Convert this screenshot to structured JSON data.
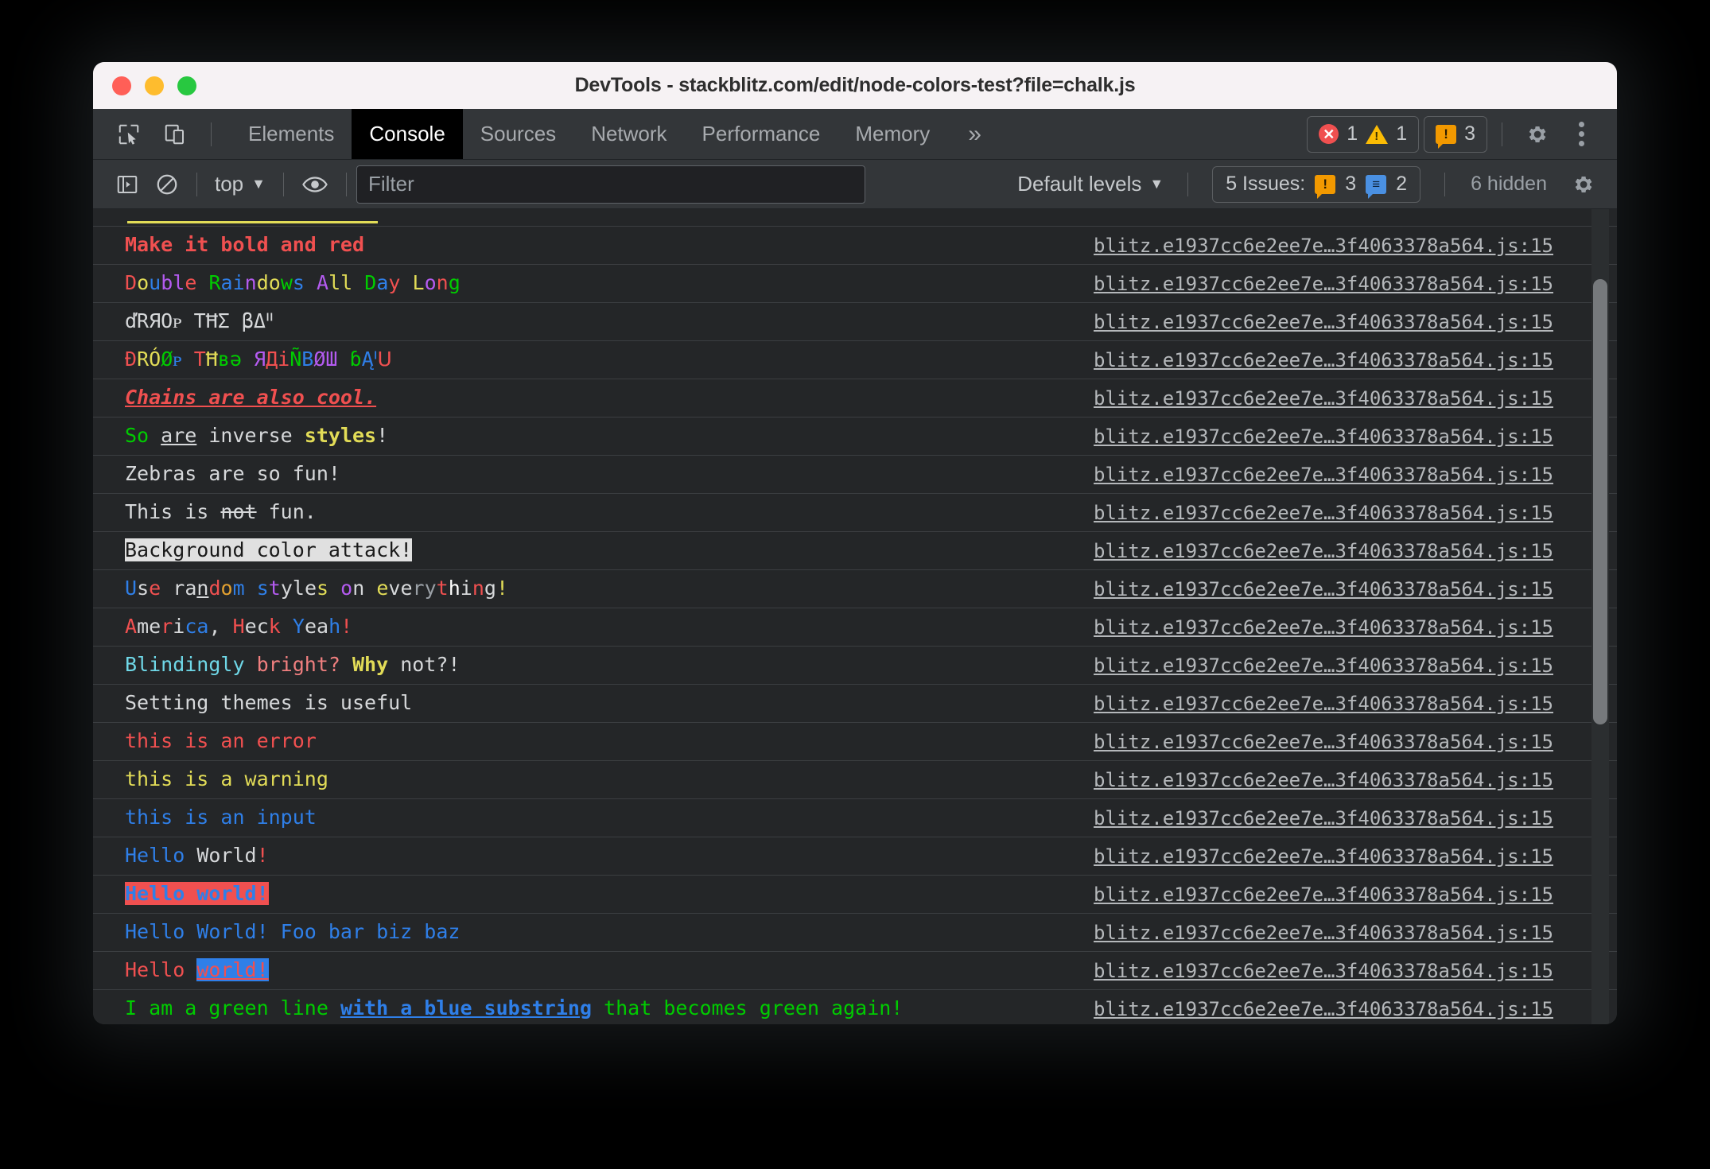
{
  "window": {
    "title": "DevTools - stackblitz.com/edit/node-colors-test?file=chalk.js",
    "traffic_lights": [
      "close",
      "minimize",
      "maximize"
    ]
  },
  "tabbar": {
    "inspect_icon": "inspect-element-icon",
    "device_icon": "device-toolbar-icon",
    "tabs": [
      {
        "label": "Elements",
        "active": false
      },
      {
        "label": "Console",
        "active": true
      },
      {
        "label": "Sources",
        "active": false
      },
      {
        "label": "Network",
        "active": false
      },
      {
        "label": "Performance",
        "active": false
      },
      {
        "label": "Memory",
        "active": false
      }
    ],
    "more_tabs_label": "»",
    "error_count": "1",
    "warning_count": "1",
    "issue_count": "3",
    "settings_icon": "gear-icon",
    "menu_icon": "kebab-menu-icon"
  },
  "console_toolbar": {
    "sidebar_icon": "console-sidebar-icon",
    "clear_icon": "clear-console-icon",
    "context_label": "top",
    "eye_icon": "live-expression-icon",
    "filter_placeholder": "Filter",
    "filter_value": "",
    "levels_label": "Default levels",
    "issues_label": "5 Issues:",
    "issues_orange_count": "3",
    "issues_blue_count": "2",
    "hidden_label": "6 hidden",
    "settings_icon": "console-settings-gear-icon"
  },
  "source_link": "blitz.e1937cc6e2ee7e…3f4063378a564.js:15",
  "colors": {
    "red": "#f05050",
    "green": "#00cc00",
    "blue": "#2f7fe8",
    "yellow": "#e2dc57",
    "magenta": "#b45bf0",
    "cyan": "#6fd8e8",
    "white": "#d6d8da",
    "grey": "#9aa0a6",
    "bg_white": "#e0e0e0",
    "bg_red": "#f05050",
    "bg_blue": "#2f7fe8"
  },
  "console_rows": [
    {
      "partial": true,
      "segments": []
    },
    {
      "segments": [
        {
          "t": "Make it bold and red",
          "c": "#f05050",
          "st": "b"
        }
      ]
    },
    {
      "segments": [
        {
          "t": "D",
          "c": "#f05050"
        },
        {
          "t": "o",
          "c": "#e2dc57"
        },
        {
          "t": "u",
          "c": "#2f7fe8"
        },
        {
          "t": "b",
          "c": "#b45bf0"
        },
        {
          "t": "l",
          "c": "#b45bf0"
        },
        {
          "t": "e",
          "c": "#f05050"
        },
        {
          "t": " ",
          "c": "#d6d8da"
        },
        {
          "t": "R",
          "c": "#00cc00"
        },
        {
          "t": "a",
          "c": "#2f7fe8"
        },
        {
          "t": "i",
          "c": "#2f7fe8"
        },
        {
          "t": "n",
          "c": "#b45bf0"
        },
        {
          "t": "d",
          "c": "#e2dc57"
        },
        {
          "t": "o",
          "c": "#e2dc57"
        },
        {
          "t": "w",
          "c": "#00cc00"
        },
        {
          "t": "s",
          "c": "#2f7fe8"
        },
        {
          "t": " ",
          "c": "#d6d8da"
        },
        {
          "t": "A",
          "c": "#b45bf0"
        },
        {
          "t": "l",
          "c": "#e2dc57"
        },
        {
          "t": "l",
          "c": "#e2dc57"
        },
        {
          "t": " ",
          "c": "#d6d8da"
        },
        {
          "t": "D",
          "c": "#00cc00"
        },
        {
          "t": "a",
          "c": "#2f7fe8"
        },
        {
          "t": "y",
          "c": "#f05050"
        },
        {
          "t": " ",
          "c": "#d6d8da"
        },
        {
          "t": "L",
          "c": "#e2dc57"
        },
        {
          "t": "o",
          "c": "#b45bf0"
        },
        {
          "t": "n",
          "c": "#f05050"
        },
        {
          "t": "g",
          "c": "#00cc00"
        }
      ]
    },
    {
      "segments": [
        {
          "t": "ďRЯOᴘ TĦΣ βΔᑊᑊ",
          "c": "#d6d8da"
        }
      ]
    },
    {
      "segments": [
        {
          "t": "Đ",
          "c": "#f05050"
        },
        {
          "t": "R",
          "c": "#e2dc57"
        },
        {
          "t": "Ó",
          "c": "#e2dc57"
        },
        {
          "t": "Ø",
          "c": "#00cc00"
        },
        {
          "t": "ᴘ",
          "c": "#2f7fe8"
        },
        {
          "t": " ",
          "c": "#d6d8da"
        },
        {
          "t": "T",
          "c": "#f05050"
        },
        {
          "t": "Ħ",
          "c": "#e2dc57"
        },
        {
          "t": "в",
          "c": "#00cc00"
        },
        {
          "t": "ә",
          "c": "#00cc00"
        },
        {
          "t": " ",
          "c": "#d6d8da"
        },
        {
          "t": "Я",
          "c": "#b45bf0"
        },
        {
          "t": "Д",
          "c": "#f05050"
        },
        {
          "t": "i",
          "c": "#f05050"
        },
        {
          "t": "Ñ",
          "c": "#00cc00"
        },
        {
          "t": "B",
          "c": "#2f7fe8"
        },
        {
          "t": "Ø",
          "c": "#b45bf0"
        },
        {
          "t": "Ш",
          "c": "#b45bf0"
        },
        {
          "t": " ",
          "c": "#d6d8da"
        },
        {
          "t": "ɓ",
          "c": "#00cc00"
        },
        {
          "t": "Ą",
          "c": "#2f7fe8"
        },
        {
          "t": "ᑊ",
          "c": "#2f7fe8"
        },
        {
          "t": "ᑌ",
          "c": "#f05050"
        }
      ]
    },
    {
      "segments": [
        {
          "t": "Chains are also cool.",
          "c": "#f05050",
          "st": "biu"
        }
      ]
    },
    {
      "segments": [
        {
          "t": "So",
          "c": "#00cc00"
        },
        {
          "t": " ",
          "c": "#d6d8da"
        },
        {
          "t": "are",
          "c": "#d6d8da",
          "st": "u"
        },
        {
          "t": " inverse ",
          "c": "#d6d8da"
        },
        {
          "t": "styles",
          "c": "#e2dc57",
          "st": "b"
        },
        {
          "t": "!",
          "c": "#d6d8da"
        }
      ]
    },
    {
      "segments": [
        {
          "t": "Zebras are so fun!",
          "c": "#d6d8da"
        }
      ]
    },
    {
      "segments": [
        {
          "t": "This is ",
          "c": "#d6d8da"
        },
        {
          "t": "not",
          "c": "#d6d8da",
          "st": "s"
        },
        {
          "t": " fun.",
          "c": "#d6d8da"
        }
      ]
    },
    {
      "segments": [
        {
          "t": "Background color attack!",
          "c": "#1a1a1a",
          "bg": "#e0e0e0"
        }
      ]
    },
    {
      "segments": [
        {
          "t": "U",
          "c": "#2f7fe8"
        },
        {
          "t": "s",
          "c": "#d6d8da"
        },
        {
          "t": "e",
          "c": "#f05050"
        },
        {
          "t": " ",
          "c": "#d6d8da"
        },
        {
          "t": "r",
          "c": "#d6d8da"
        },
        {
          "t": "a",
          "c": "#d6d8da"
        },
        {
          "t": "n",
          "c": "#d6d8da",
          "st": "u"
        },
        {
          "t": "d",
          "c": "#f05050"
        },
        {
          "t": "o",
          "c": "#e2a030"
        },
        {
          "t": "m",
          "c": "#2f7fe8"
        },
        {
          "t": " ",
          "c": "#d6d8da"
        },
        {
          "t": "s",
          "c": "#2f7fe8"
        },
        {
          "t": "t",
          "c": "#b45bf0"
        },
        {
          "t": "y",
          "c": "#d6d8da"
        },
        {
          "t": "l",
          "c": "#d6d8da"
        },
        {
          "t": "e",
          "c": "#d6d8da"
        },
        {
          "t": "s",
          "c": "#e2dc57"
        },
        {
          "t": " ",
          "c": "#d6d8da"
        },
        {
          "t": "o",
          "c": "#b45bf0"
        },
        {
          "t": "n",
          "c": "#d6d8da"
        },
        {
          "t": " ",
          "c": "#d6d8da"
        },
        {
          "t": "e",
          "c": "#e2dc57"
        },
        {
          "t": "v",
          "c": "#d6d8da"
        },
        {
          "t": "e",
          "c": "#d6d8da"
        },
        {
          "t": "r",
          "c": "#9aa0a6"
        },
        {
          "t": "y",
          "c": "#9aa0a6"
        },
        {
          "t": "t",
          "c": "#f05050"
        },
        {
          "t": "h",
          "c": "#ffffff"
        },
        {
          "t": "i",
          "c": "#d6d8da"
        },
        {
          "t": "n",
          "c": "#f05050"
        },
        {
          "t": "g",
          "c": "#d6d8da"
        },
        {
          "t": "!",
          "c": "#e2dc57"
        }
      ]
    },
    {
      "segments": [
        {
          "t": "A",
          "c": "#f05050"
        },
        {
          "t": "m",
          "c": "#d6d8da"
        },
        {
          "t": "e",
          "c": "#d6d8da"
        },
        {
          "t": "r",
          "c": "#f05050"
        },
        {
          "t": "i",
          "c": "#d6d8da"
        },
        {
          "t": "c",
          "c": "#2f7fe8"
        },
        {
          "t": "a",
          "c": "#2f7fe8"
        },
        {
          "t": ",",
          "c": "#d6d8da"
        },
        {
          "t": " ",
          "c": "#d6d8da"
        },
        {
          "t": "H",
          "c": "#f05050"
        },
        {
          "t": "e",
          "c": "#d6d8da"
        },
        {
          "t": "c",
          "c": "#d6d8da"
        },
        {
          "t": "k",
          "c": "#f05050"
        },
        {
          "t": " ",
          "c": "#d6d8da"
        },
        {
          "t": "Y",
          "c": "#2f7fe8"
        },
        {
          "t": "e",
          "c": "#d6d8da"
        },
        {
          "t": "a",
          "c": "#d6d8da"
        },
        {
          "t": "h",
          "c": "#2f7fe8"
        },
        {
          "t": "!",
          "c": "#f05050"
        }
      ]
    },
    {
      "segments": [
        {
          "t": "Blindingly",
          "c": "#6fd8e8"
        },
        {
          "t": " ",
          "c": "#d6d8da"
        },
        {
          "t": "bright?",
          "c": "#f07f7f"
        },
        {
          "t": " ",
          "c": "#d6d8da"
        },
        {
          "t": "Why",
          "c": "#e2dc57",
          "st": "b"
        },
        {
          "t": " not?!",
          "c": "#d6d8da"
        }
      ]
    },
    {
      "segments": [
        {
          "t": "Setting themes is useful",
          "c": "#d6d8da"
        }
      ]
    },
    {
      "segments": [
        {
          "t": "this is an error",
          "c": "#f05050"
        }
      ]
    },
    {
      "segments": [
        {
          "t": "this is a warning",
          "c": "#e2dc57"
        }
      ]
    },
    {
      "segments": [
        {
          "t": "this is an input",
          "c": "#2f7fe8"
        }
      ]
    },
    {
      "segments": [
        {
          "t": "Hello",
          "c": "#2f7fe8"
        },
        {
          "t": " ",
          "c": "#d6d8da"
        },
        {
          "t": "World",
          "c": "#d6d8da"
        },
        {
          "t": "!",
          "c": "#f05050"
        }
      ]
    },
    {
      "segments": [
        {
          "t": "Hello world!",
          "c": "#2f7fe8",
          "bg": "#f05050",
          "st": "b"
        }
      ]
    },
    {
      "segments": [
        {
          "t": "Hello World! Foo bar biz baz",
          "c": "#2f7fe8"
        }
      ]
    },
    {
      "segments": [
        {
          "t": "Hello ",
          "c": "#f05050"
        },
        {
          "t": "world!",
          "c": "#f05050",
          "bg": "#2f7fe8",
          "st": "u"
        }
      ]
    },
    {
      "segments": [
        {
          "t": "I am a green line ",
          "c": "#00cc00"
        },
        {
          "t": "with a blue substring",
          "c": "#2f7fe8",
          "st": "bu"
        },
        {
          "t": " that becomes green again!",
          "c": "#00cc00"
        }
      ]
    },
    {
      "segments": [],
      "no_border": true
    }
  ]
}
